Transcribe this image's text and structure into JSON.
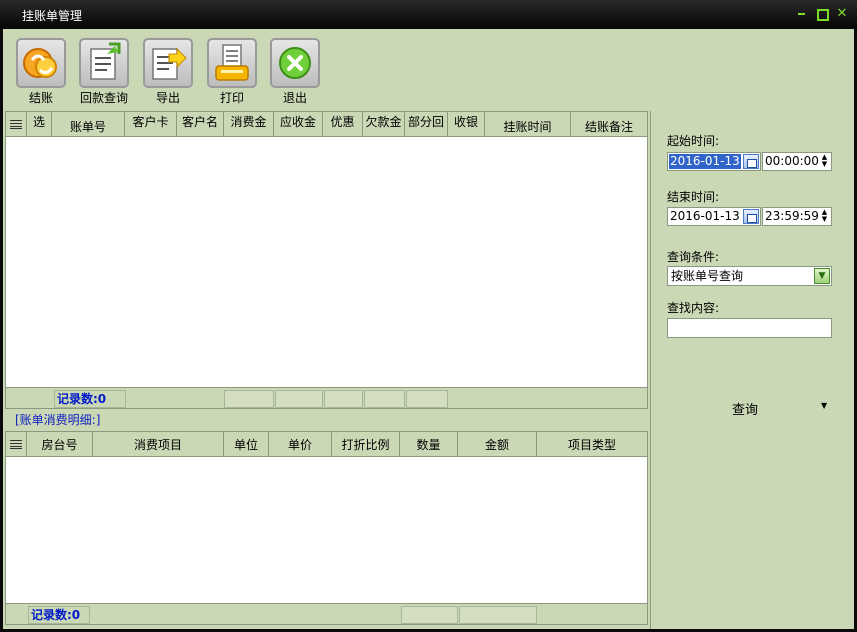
{
  "window": {
    "title": "挂账单管理",
    "close_glyph": "✕"
  },
  "toolbar": {
    "items": [
      {
        "label": "结账",
        "icon": "coins-icon"
      },
      {
        "label": "回款查询",
        "icon": "document-refresh-icon"
      },
      {
        "label": "导出",
        "icon": "export-icon"
      },
      {
        "label": "打印",
        "icon": "printer-icon"
      },
      {
        "label": "退出",
        "icon": "exit-icon"
      }
    ]
  },
  "top_grid": {
    "columns": [
      "选",
      "账单号",
      "客户卡",
      "客户名",
      "消费金",
      "应收金",
      "优惠",
      "欠款金",
      "部分回",
      "收银",
      "挂账时间",
      "结账备注"
    ],
    "rows": [],
    "record_count_label": "记录数:0"
  },
  "detail": {
    "label": "[账单消费明细:]",
    "columns": [
      "房台号",
      "消费项目",
      "单位",
      "单价",
      "打折比例",
      "数量",
      "金额",
      "项目类型"
    ],
    "rows": [],
    "record_count_label": "记录数:0"
  },
  "filters": {
    "start_label": "起始时间:",
    "start_date": "2016-01-13",
    "start_time": "00:00:00",
    "end_label": "结束时间:",
    "end_date": "2016-01-13",
    "end_time": "23:59:59",
    "condition_label": "查询条件:",
    "condition_value": "按账单号查询",
    "search_label": "查找内容:",
    "search_value": "",
    "query_button": "查询",
    "query_arrow": "▼",
    "spin_up": "▲",
    "spin_down": "▼",
    "dropdown_glyph": "▼"
  },
  "colors": {
    "panel": "#cbd8b6",
    "accent": "#0018c8",
    "selection": "#3064c8",
    "titlebar": "#050505"
  }
}
